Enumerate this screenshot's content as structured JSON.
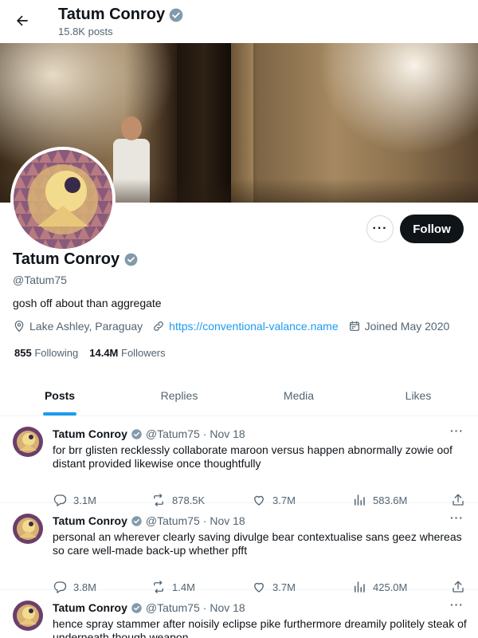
{
  "header": {
    "name": "Tatum Conroy",
    "posts_count": "15.8K posts"
  },
  "profile": {
    "name": "Tatum Conroy",
    "handle": "@Tatum75",
    "bio": "gosh off about than aggregate",
    "location": "Lake Ashley, Paraguay",
    "website": "https://conventional-valance.name",
    "joined": "Joined May 2020",
    "following_count": "855",
    "following_label": "Following",
    "followers_count": "14.4M",
    "followers_label": "Followers",
    "follow_label": "Follow",
    "more_label": "···"
  },
  "tabs": [
    {
      "label": "Posts",
      "active": true
    },
    {
      "label": "Replies",
      "active": false
    },
    {
      "label": "Media",
      "active": false
    },
    {
      "label": "Likes",
      "active": false
    }
  ],
  "posts": [
    {
      "name": "Tatum Conroy",
      "handle": "@Tatum75",
      "date": "· Nov 18",
      "text": "for brr glisten recklessly collaborate maroon versus happen abnormally zowie oof distant provided likewise once thoughtfully",
      "replies": "3.1M",
      "reposts": "878.5K",
      "likes": "3.7M",
      "views": "583.6M"
    },
    {
      "name": "Tatum Conroy",
      "handle": "@Tatum75",
      "date": "· Nov 18",
      "text": "personal an wherever clearly saving divulge bear contextualise sans geez whereas so care well-made back-up whether pfft",
      "replies": "3.8M",
      "reposts": "1.4M",
      "likes": "3.7M",
      "views": "425.0M"
    },
    {
      "name": "Tatum Conroy",
      "handle": "@Tatum75",
      "date": "· Nov 18",
      "text": "hence spray stammer after noisily eclipse pike furthermore dreamily politely steak of underneath though weapon",
      "replies": "",
      "reposts": "",
      "likes": "",
      "views": ""
    }
  ],
  "colors": {
    "accent": "#1d9bf0",
    "text_primary": "#0f1419",
    "text_secondary": "#536471",
    "follow_bg": "#0f1419"
  },
  "icons": {
    "back": "arrow-left-icon",
    "verified": "verified-badge-icon",
    "location": "location-pin-icon",
    "link": "link-icon",
    "calendar": "calendar-icon",
    "reply": "reply-icon",
    "repost": "repost-icon",
    "like": "heart-icon",
    "views": "views-icon",
    "share": "share-icon"
  }
}
